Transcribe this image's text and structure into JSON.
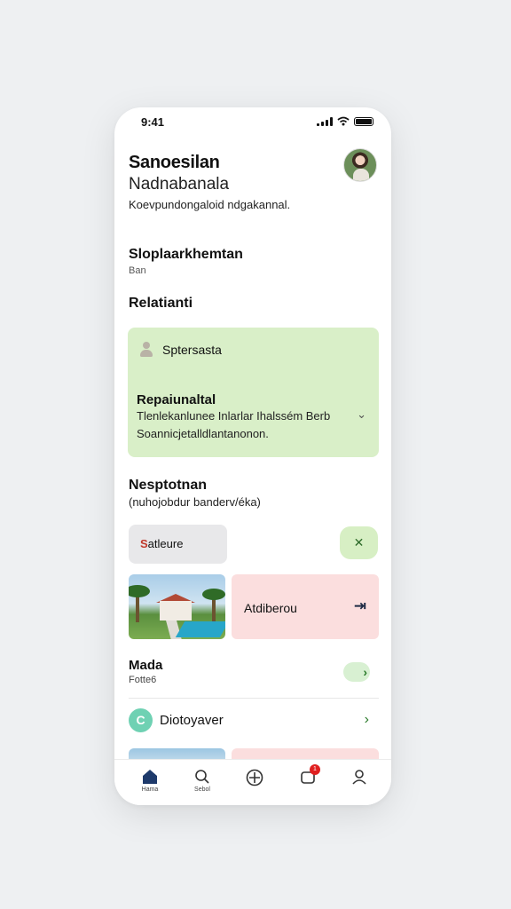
{
  "status": {
    "time": "9:41"
  },
  "header": {
    "title": "Sanoesilan",
    "subtitle": "Nadnabanala",
    "description": "Koevpundongaloid ndgakannal."
  },
  "section_one": {
    "title": "Sloplaarkhemtan",
    "subtitle": "Ban"
  },
  "section_two": {
    "title": "Relatianti"
  },
  "green_card": {
    "user_name": "Sptersasta",
    "title": "Repaiunaltal",
    "line1": "Tlenlekanlunee Inlarlar Ihalssém Berb",
    "line2": "Soannicjetalldlantanonon.",
    "chevron": "⌄"
  },
  "section_three": {
    "title": "Nesptotnan",
    "subtitle": "(nuhojobdur banderv/éka)"
  },
  "grey_pill": {
    "label": "atleure",
    "initial": "S"
  },
  "green_button": {
    "label": "✕"
  },
  "pink_card": {
    "label": "Atdiberou",
    "arrow": "⇥"
  },
  "row_one": {
    "title": "Mada",
    "subtitle": "Fotte6",
    "chevron": "›"
  },
  "row_two": {
    "title": "Diotoyaver",
    "icon_letter": "C",
    "chevron": "›"
  },
  "tabbar": {
    "items": [
      {
        "label": "Hama",
        "icon": "home-icon",
        "active": true
      },
      {
        "label": "Sebol",
        "icon": "search-icon",
        "active": false
      },
      {
        "label": "",
        "icon": "add-icon",
        "active": false
      },
      {
        "label": "",
        "icon": "bag-icon",
        "active": false,
        "badge": "1"
      },
      {
        "label": "",
        "icon": "profile-icon",
        "active": false
      }
    ]
  },
  "colors": {
    "green_card": "#d9efc8",
    "pink_card": "#fbdede",
    "accent_green": "#2a7a2a",
    "badge_red": "#e02020",
    "active_tab": "#1e3a6b"
  }
}
